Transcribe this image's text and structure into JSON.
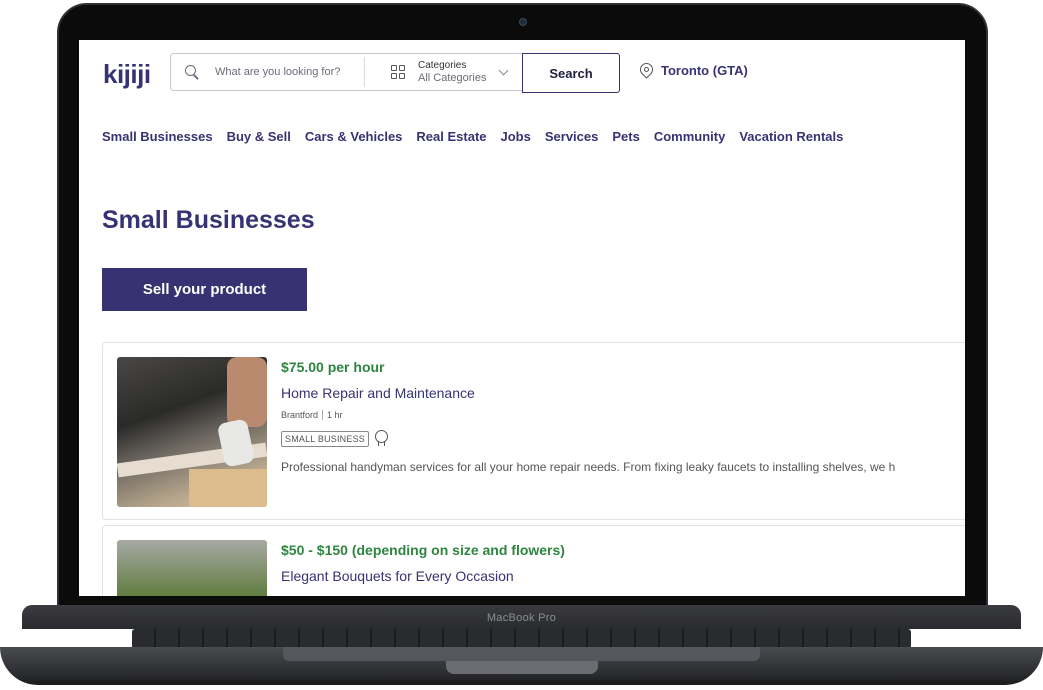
{
  "device": {
    "label": "MacBook Pro"
  },
  "header": {
    "logo": "kijiji",
    "search": {
      "placeholder": "What are you looking for?",
      "value": ""
    },
    "categories": {
      "title": "Categories",
      "value": "All Categories"
    },
    "search_button": "Search",
    "location": "Toronto (GTA)"
  },
  "nav": {
    "items": [
      "Small Businesses",
      "Buy & Sell",
      "Cars & Vehicles",
      "Real Estate",
      "Jobs",
      "Services",
      "Pets",
      "Community",
      "Vacation Rentals"
    ]
  },
  "page": {
    "title": "Small Businesses",
    "sell_button": "Sell your product"
  },
  "listings": [
    {
      "price": "$75.00 per hour",
      "title": "Home Repair and Maintenance",
      "location": "Brantford",
      "time": "1 hr",
      "badge": "SMALL BUSINESS",
      "description": "Professional handyman services for all your home repair needs. From fixing leaky faucets to installing shelves, we h"
    },
    {
      "price": "$50 - $150 (depending on size and flowers)",
      "title": "Elegant Bouquets for Every Occasion"
    }
  ],
  "colors": {
    "brand": "#373373",
    "price": "#2e8540",
    "logo_accent": "#f8aa17"
  }
}
